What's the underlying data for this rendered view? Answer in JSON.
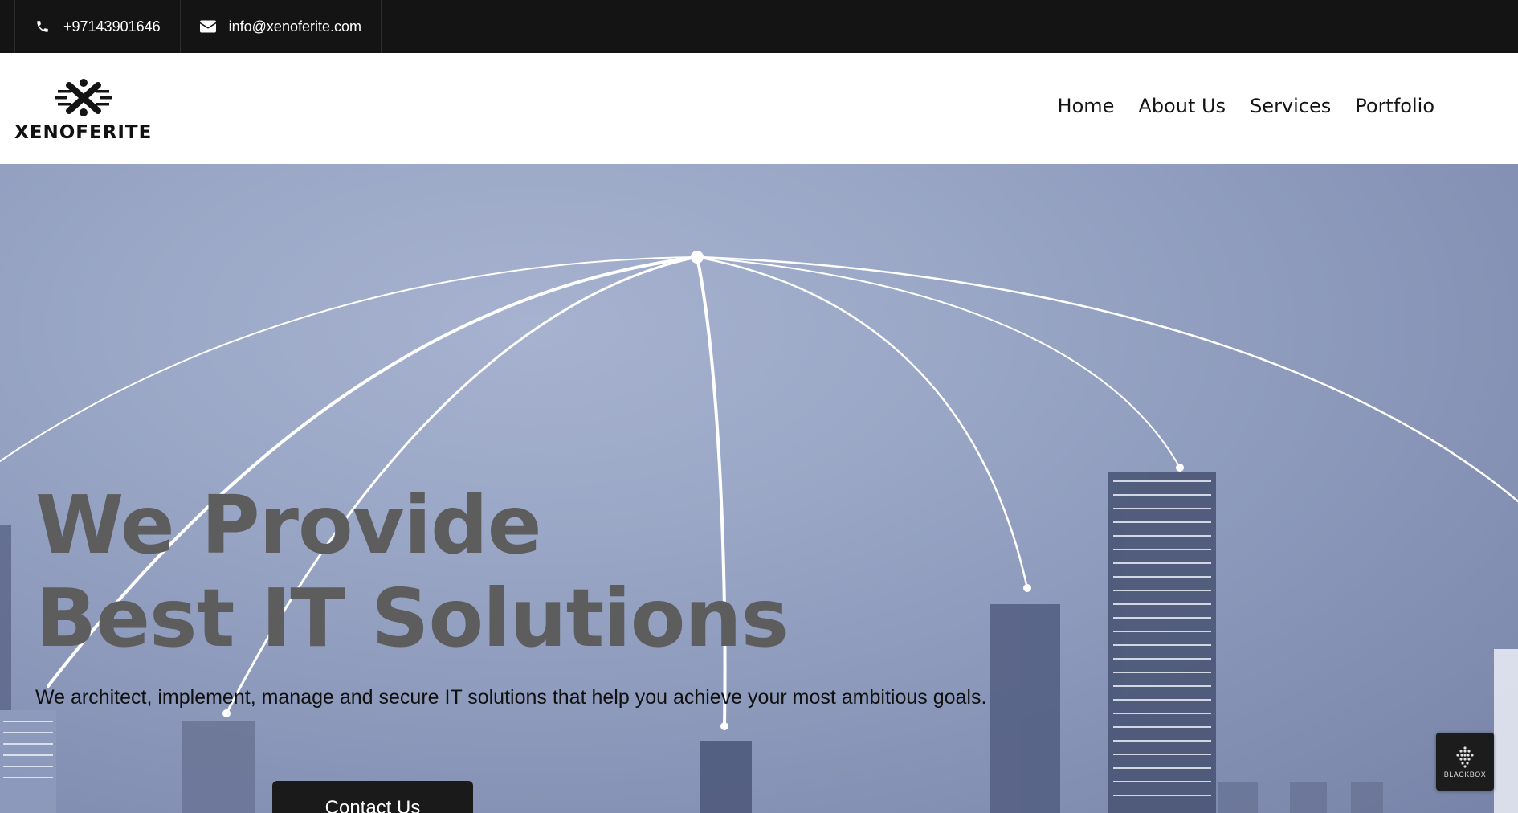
{
  "topbar": {
    "phone": "+97143901646",
    "email": "info@xenoferite.com",
    "phone_icon": "phone-icon",
    "email_icon": "envelope-icon"
  },
  "header": {
    "logo_text": "XENOFERITE",
    "nav": [
      {
        "label": "Home"
      },
      {
        "label": "About Us"
      },
      {
        "label": "Services"
      },
      {
        "label": "Portfolio"
      }
    ]
  },
  "hero": {
    "title_line1": "We Provide",
    "title_line2": "Best IT Solutions",
    "subtitle": "We architect, implement, manage and secure IT solutions that help you achieve your most ambitious goals.",
    "cta": "Contact Us"
  },
  "badge": {
    "label": "BLACKBOX",
    "icon": "blackbox-logo-icon"
  },
  "colors": {
    "topbar_bg": "#141414",
    "hero_title": "#5d5d5d",
    "button_bg": "#1a1a1a"
  }
}
